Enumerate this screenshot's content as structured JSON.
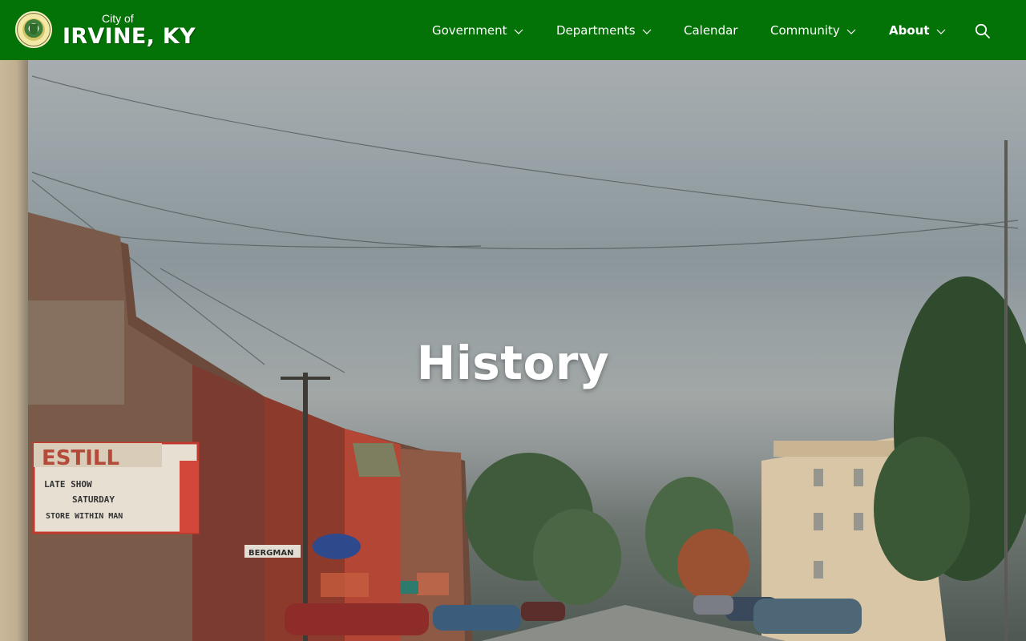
{
  "site": {
    "city_prefix": "City of",
    "city_name": "IRVINE, KY"
  },
  "nav": {
    "items": [
      {
        "label": "Government",
        "has_dropdown": true
      },
      {
        "label": "Departments",
        "has_dropdown": true
      },
      {
        "label": "Calendar",
        "has_dropdown": false
      },
      {
        "label": "Community",
        "has_dropdown": true
      },
      {
        "label": "About",
        "has_dropdown": true,
        "active": true
      }
    ],
    "search_icon": "search-icon"
  },
  "hero": {
    "title": "History",
    "sign_marquee_top": "ESTILL",
    "sign_line1": "LATE   SHOW",
    "sign_line2": "SATURDAY",
    "sign_line3": "STORE WITHIN MAN",
    "store_sign": "BERGMAN"
  },
  "colors": {
    "header_green": "#047307",
    "text_white": "#ffffff"
  }
}
